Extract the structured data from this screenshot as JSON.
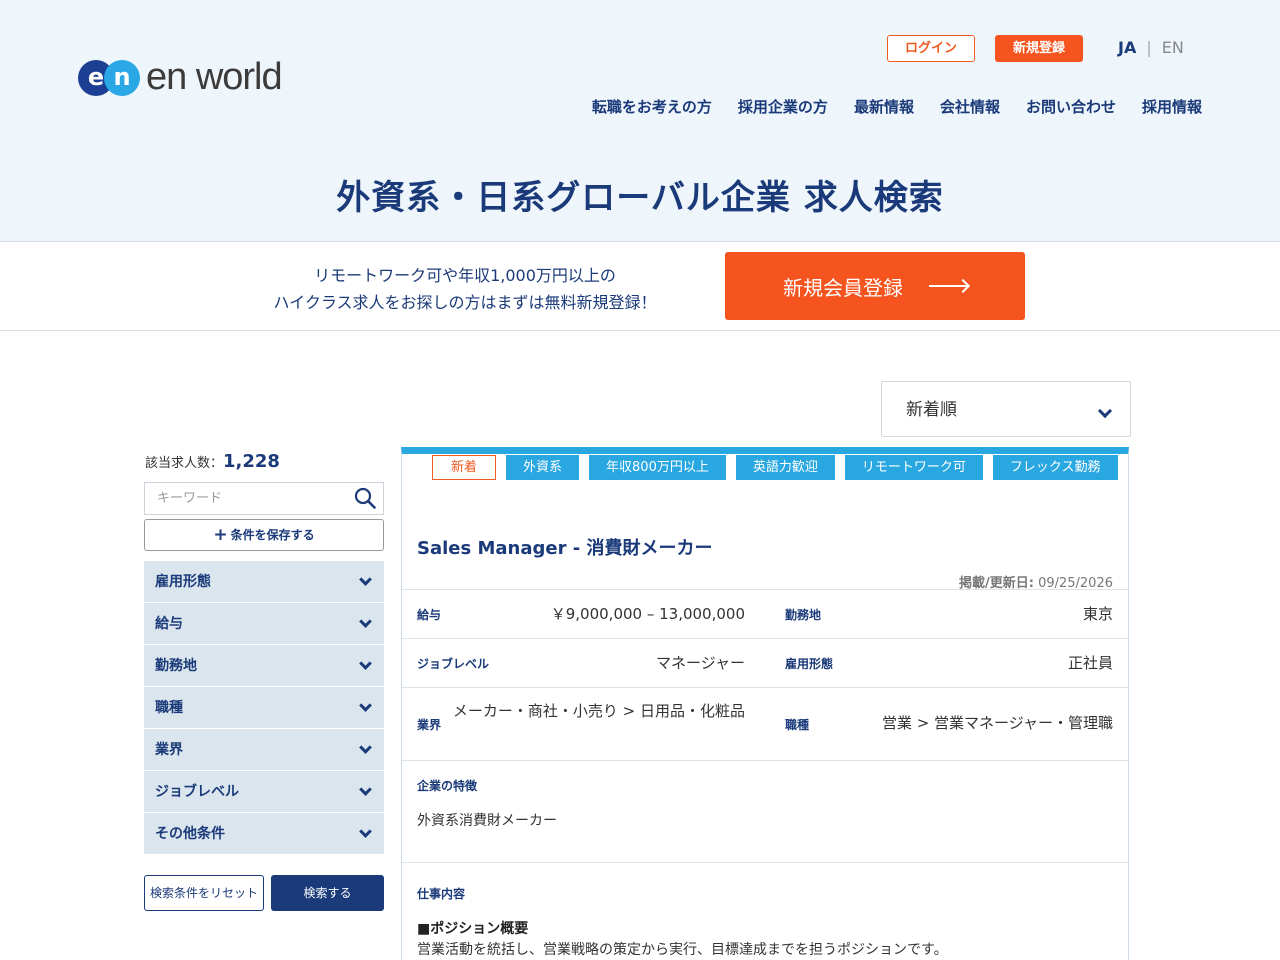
{
  "header": {
    "logo_text": "en world",
    "logo_mark": [
      "e",
      "n"
    ],
    "login": "ログイン",
    "register": "新規登録",
    "lang_ja": "JA",
    "lang_sep": "|",
    "lang_en": "EN",
    "nav": [
      "転職をお考えの方",
      "採用企業の方",
      "最新情報",
      "会社情報",
      "お問い合わせ",
      "採用情報"
    ]
  },
  "hero": {
    "title": "外資系・日系グローバル企業 求人検索"
  },
  "promo": {
    "line1": "リモートワーク可や年収1,000万円以上の",
    "line2": "ハイクラス求人をお探しの方はまずは無料新規登録！",
    "button": "新規会員登録"
  },
  "sort": {
    "selected": "新着順"
  },
  "sidebar": {
    "count_label": "該当求人数：",
    "count_value": "1,228",
    "keyword_placeholder": "キーワード",
    "save_label": "条件を保存する",
    "filters": [
      "雇用形態",
      "給与",
      "勤務地",
      "職種",
      "業界",
      "ジョブレベル",
      "その他条件"
    ],
    "reset": "検索条件をリセット",
    "search": "検索する"
  },
  "job": {
    "tags": [
      "新着",
      "外資系",
      "年収800万円以上",
      "英語力歓迎",
      "リモートワーク可",
      "フレックス勤務"
    ],
    "title": "Sales Manager - 消費財メーカー",
    "updated_label": "掲載/更新日:",
    "updated_value": "09/25/2026",
    "salary_label": "給与",
    "salary_value": "￥9,000,000 – 13,000,000",
    "location_label": "勤務地",
    "location_value": "東京",
    "level_label": "ジョブレベル",
    "level_value": "マネージャー",
    "employment_label": "雇用形態",
    "employment_value": "正社員",
    "industry_label": "業界",
    "industry_value": "メーカー・商社・小売り > 日用品・化粧品",
    "function_label": "職種",
    "function_value": "営業 > 営業マネージャー・管理職",
    "company_label": "企業の特徴",
    "company_value": "外資系消費財メーカー",
    "duty_label": "仕事内容",
    "position_heading": "■ポジション概要",
    "position_text": "営業活動を統括し、営業戦略の策定から実行、目標達成までを担うポジションです。"
  },
  "colors": {
    "navy": "#1b3a7a",
    "orange": "#f5541f",
    "sky": "#29a7e1",
    "header_bg": "#eef5fb"
  }
}
